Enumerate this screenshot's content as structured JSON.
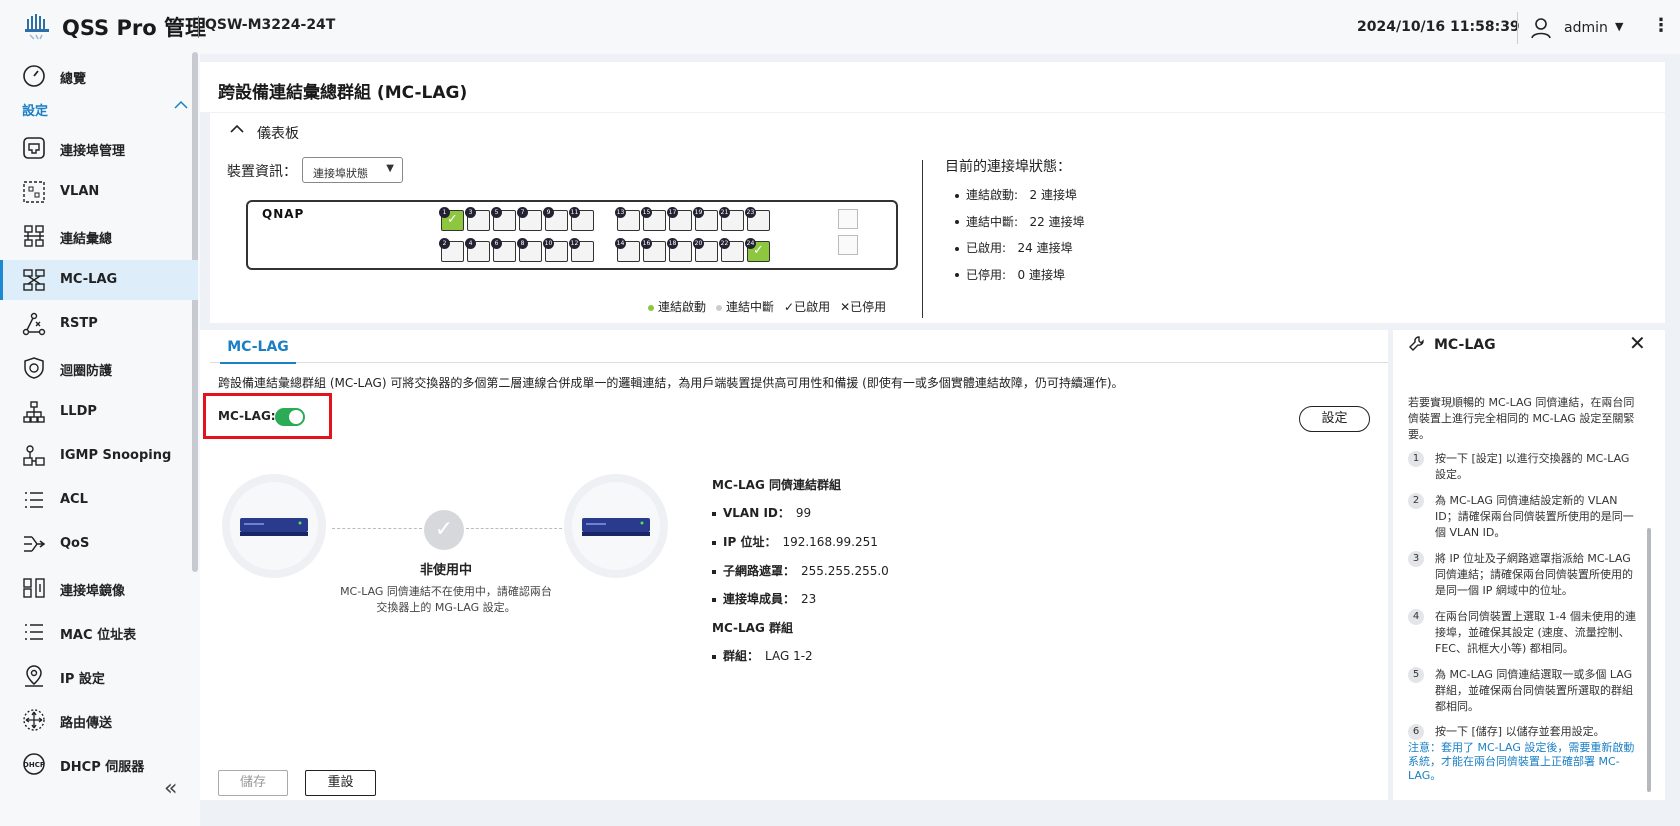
{
  "header": {
    "app_title": "QSS Pro 管理",
    "model": "QSW-M3224-24T",
    "datetime": "2024/10/16 11:58:39",
    "user": "admin"
  },
  "sidebar": {
    "section": "設定",
    "items": [
      {
        "label": "總覽",
        "icon": "gauge-icon"
      },
      {
        "label": "連接埠管理",
        "icon": "port-icon"
      },
      {
        "label": "VLAN",
        "icon": "vlan-icon"
      },
      {
        "label": "連結彙總",
        "icon": "link-aggregation-icon"
      },
      {
        "label": "MC-LAG",
        "icon": "mclag-icon"
      },
      {
        "label": "RSTP",
        "icon": "rstp-icon"
      },
      {
        "label": "迴圈防護",
        "icon": "loop-protection-icon"
      },
      {
        "label": "LLDP",
        "icon": "lldp-icon"
      },
      {
        "label": "IGMP Snooping",
        "icon": "igmp-icon"
      },
      {
        "label": "ACL",
        "icon": "acl-icon"
      },
      {
        "label": "QoS",
        "icon": "qos-icon"
      },
      {
        "label": "連接埠鏡像",
        "icon": "port-mirror-icon"
      },
      {
        "label": "MAC 位址表",
        "icon": "mac-table-icon"
      },
      {
        "label": "IP 設定",
        "icon": "ip-icon"
      },
      {
        "label": "路由傳送",
        "icon": "routing-icon"
      },
      {
        "label": "DHCP 伺服器",
        "icon": "dhcp-icon"
      }
    ]
  },
  "page": {
    "title": "跨設備連結彙總群組 (MC-LAG)"
  },
  "dashboard": {
    "title": "儀表板",
    "device_info_label": "裝置資訊：",
    "device_select": "連接埠狀態",
    "brand": "QNAP",
    "top_ports": [
      "1",
      "3",
      "5",
      "7",
      "9",
      "11",
      "13",
      "15",
      "17",
      "19",
      "21",
      "23"
    ],
    "bottom_ports": [
      "2",
      "4",
      "6",
      "8",
      "10",
      "12",
      "14",
      "16",
      "18",
      "20",
      "22",
      "24"
    ],
    "up_ports": [
      "1",
      "24"
    ],
    "legend": {
      "up": "連結啟動",
      "down": "連結中斷",
      "enabled": "✓已啟用",
      "disabled": "✕已停用"
    },
    "status_title": "目前的連接埠狀態：",
    "status": [
      {
        "k": "連結啟動:",
        "v": "2 連接埠"
      },
      {
        "k": "連結中斷:",
        "v": "22 連接埠"
      },
      {
        "k": "已啟用:",
        "v": "24 連接埠"
      },
      {
        "k": "已停用:",
        "v": "0 連接埠"
      }
    ],
    "colors": {
      "up": "#8dc63f",
      "accent": "#1a7fc4",
      "toggle_on": "#2bab55",
      "highlight": "#e1141e"
    }
  },
  "content": {
    "tab": "MC-LAG",
    "description": "跨設備連結彙總群組 (MC-LAG) 可將交換器的多個第二層連線合併成單一的邏輯連結，為用戶端裝置提供高可用性和備援 (即使有一或多個實體連結故障，仍可持續運作)。",
    "mclag_label": "MC-LAG:",
    "mclag_enabled": true,
    "settings_button": "設定",
    "inactive_title": "非使用中",
    "inactive_desc1": "MC-LAG 同儕連結不在使用中，請確認兩台",
    "inactive_desc2": "交換器上的 MG-LAG 設定。",
    "peer_group_title": "MC-LAG 同儕連結群組",
    "peer_rows": [
      {
        "k": "VLAN ID：",
        "v": "99"
      },
      {
        "k": "IP 位址：",
        "v": "192.168.99.251"
      },
      {
        "k": "子網路遮罩：",
        "v": "255.255.255.0"
      },
      {
        "k": "連接埠成員：",
        "v": "23"
      }
    ],
    "group_title": "MC-LAG 群組",
    "group_rows": [
      {
        "k": "群組：",
        "v": "LAG 1-2"
      }
    ],
    "save_button": "儲存",
    "reset_button": "重設"
  },
  "help": {
    "title": "MC-LAG",
    "intro": "若要實現順暢的 MC-LAG 同儕連結，在兩台同儕裝置上進行完全相同的 MC-LAG 設定至關緊要。",
    "steps": [
      {
        "n": "1",
        "t": "按一下 [設定] 以進行交換器的 MC-LAG 設定。"
      },
      {
        "n": "2",
        "t": "為 MC-LAG 同儕連結設定新的 VLAN ID；請確保兩台同儕裝置所使用的是同一個 VLAN ID。"
      },
      {
        "n": "3",
        "t": "將 IP 位址及子網路遮罩指派給 MC-LAG 同儕連結；請確保兩台同儕裝置所使用的是同一個 IP 網域中的位址。"
      },
      {
        "n": "4",
        "t": "在兩台同儕裝置上選取 1-4 個未使用的連接埠，並確保其設定 (速度、流量控制、FEC、訊框大小等) 都相同。"
      },
      {
        "n": "5",
        "t": "為 MC-LAG 同儕連結選取一或多個 LAG 群組，並確保兩台同儕裝置所選取的群組都相同。"
      },
      {
        "n": "6",
        "t": "按一下 [儲存] 以儲存並套用設定。"
      }
    ],
    "note": "注意：套用了 MC-LAG 設定後，需要重新啟動系統，才能在兩台同儕裝置上正確部署 MC-LAG。"
  }
}
